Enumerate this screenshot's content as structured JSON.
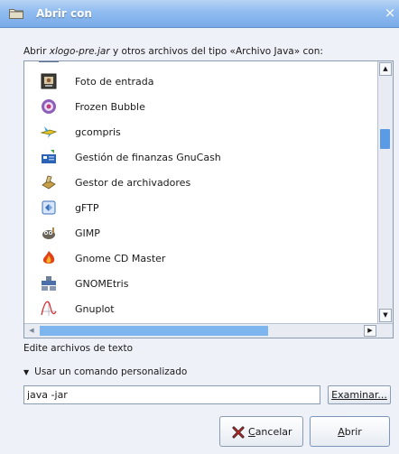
{
  "window": {
    "title": "Abrir con",
    "close_glyph": "×"
  },
  "description": {
    "prefix": "Abrir ",
    "filename": "xlogo-pre.jar",
    "suffix": " y otros archivos del tipo «Archivo Java» con:"
  },
  "apps": [
    {
      "label": "Foto de entrada",
      "icon": "photo-booth-icon"
    },
    {
      "label": "Frozen Bubble",
      "icon": "frozen-bubble-icon"
    },
    {
      "label": "gcompris",
      "icon": "gcompris-icon"
    },
    {
      "label": "Gestión de finanzas GnuCash",
      "icon": "gnucash-icon"
    },
    {
      "label": "Gestor de archivadores",
      "icon": "archive-manager-icon"
    },
    {
      "label": "gFTP",
      "icon": "gftp-icon"
    },
    {
      "label": "GIMP",
      "icon": "gimp-icon"
    },
    {
      "label": "Gnome CD Master",
      "icon": "cd-master-icon"
    },
    {
      "label": "GNOMEtris",
      "icon": "gnometris-icon"
    },
    {
      "label": "Gnuplot",
      "icon": "gnuplot-icon"
    }
  ],
  "app_description": "Edite archivos de texto",
  "custom_command": {
    "expander_label": "Usar un comando personalizado",
    "value": "java -jar",
    "browse_label": "Examinar..."
  },
  "buttons": {
    "cancel_mnemonic": "C",
    "cancel_rest": "ancelar",
    "open_mnemonic": "A",
    "open_rest": "brir"
  },
  "list_scroll": {
    "vertical_fraction": 0.31,
    "horizontal_visible_fraction": 0.66
  },
  "colors": {
    "titlebar": "#8fbbef",
    "scroll_thumb": "#5b9be6",
    "window_bg": "#eef1f7"
  }
}
